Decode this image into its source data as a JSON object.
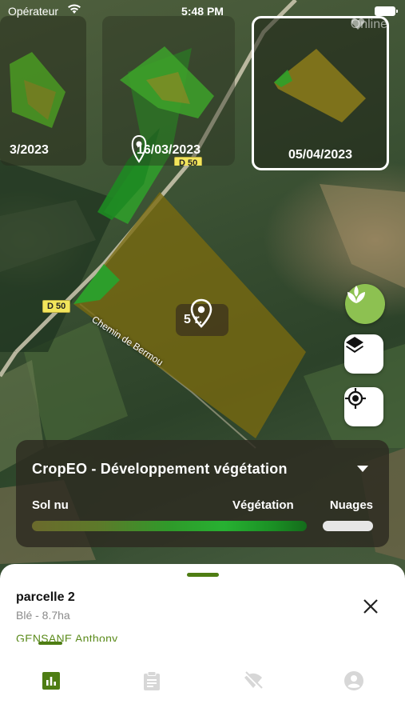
{
  "status_bar": {
    "carrier": "Opérateur",
    "time": "5:48 PM"
  },
  "connection": {
    "label": "Online"
  },
  "dates": [
    {
      "label": "3/2023"
    },
    {
      "label": "16/03/2023"
    },
    {
      "label": "05/04/2023",
      "selected": true
    }
  ],
  "map": {
    "road_labels": [
      "D 50",
      "D 50"
    ],
    "street_label": "Chemin de Bermou",
    "parcel_badge": "5 ha",
    "parcel_badge_visible": "5   r.",
    "thumb_badge": "5"
  },
  "map_controls": {
    "vegetation_icon": "leaf-icon",
    "layers_icon": "layers-icon",
    "locate_icon": "locate-icon"
  },
  "legend": {
    "title": "CropEO - Développement végétation",
    "left_label": "Sol nu",
    "mid_label": "Végétation",
    "right_label": "Nuages",
    "colors": {
      "bare": "#6b6a2c",
      "veg": "#27b132",
      "cloud": "#e6e6e6"
    }
  },
  "parcel": {
    "name": "parcelle 2",
    "info": "Blé - 8.7ha",
    "owner": "GENSANE Anthony"
  },
  "tabs": [
    {
      "icon": "chart-icon",
      "active": true
    },
    {
      "icon": "clipboard-icon",
      "active": false
    },
    {
      "icon": "no-signal-icon",
      "active": false
    },
    {
      "icon": "user-icon",
      "active": false
    }
  ],
  "accent": "#4e7d13"
}
